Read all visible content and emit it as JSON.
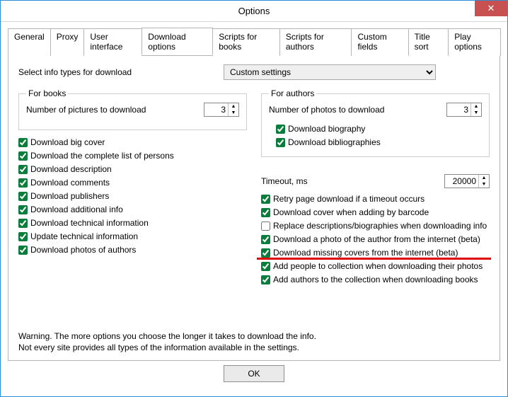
{
  "window": {
    "title": "Options"
  },
  "tabs": {
    "general": "General",
    "proxy": "Proxy",
    "ui": "User interface",
    "download": "Download options",
    "scriptsBooks": "Scripts for books",
    "scriptsAuthors": "Scripts for authors",
    "customFields": "Custom fields",
    "titleSort": "Title sort",
    "playOptions": "Play options"
  },
  "topRow": {
    "label": "Select info types for download",
    "selected": "Custom settings"
  },
  "books": {
    "legend": "For books",
    "numLabel": "Number of pictures to download",
    "numValue": "3",
    "items": [
      "Download big cover",
      "Download the complete list of persons",
      "Download description",
      "Download comments",
      "Download publishers",
      "Download additional info",
      "Download technical information",
      "Update technical information",
      "Download photos of authors"
    ]
  },
  "authors": {
    "legend": "For authors",
    "numLabel": "Number of photos to download",
    "numValue": "3",
    "items": [
      "Download biography",
      "Download bibliographies"
    ]
  },
  "timeout": {
    "label": "Timeout, ms",
    "value": "20000"
  },
  "misc": {
    "items": [
      "Retry page download if a timeout occurs",
      "Download cover when adding by barcode",
      "Replace descriptions/biographies when downloading info",
      "Download a photo of the author from the internet (beta)",
      "Download missing covers from the internet (beta)",
      "Add people to collection when downloading their photos",
      "Add authors to the collection when downloading books"
    ]
  },
  "warning": {
    "l1": "Warning. The more options you choose the longer it takes to download the info.",
    "l2": "Not every site provides all types of the information available in the settings."
  },
  "buttons": {
    "ok": "OK"
  }
}
